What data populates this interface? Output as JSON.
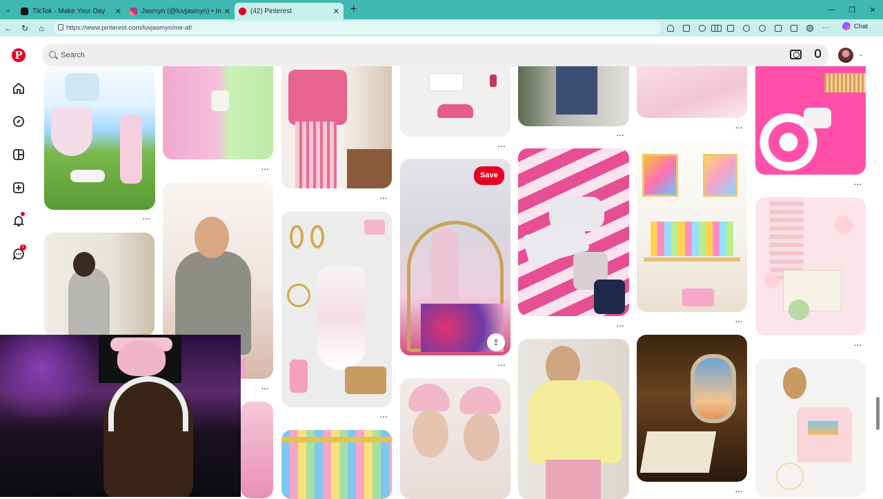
{
  "browser": {
    "tabs": [
      {
        "title": "TikTok - Make Your Day",
        "active": false,
        "favicon_color": "#111111"
      },
      {
        "title": "Jasmyn (@luvjasmyn) • Instagram",
        "active": false,
        "favicon_color": "#d62976"
      },
      {
        "title": "(42) Pinterest",
        "active": true,
        "favicon_color": "#e60023"
      }
    ],
    "new_tab_label": "+",
    "url": "https://www.pinterest.com/luvjasmyn/me-af/",
    "chat_label": "Chat",
    "accent_color": "#3fb8af"
  },
  "pinterest": {
    "brand_color": "#e60023",
    "search_placeholder": "Search",
    "notification_badge": "",
    "messages_badge": "1",
    "save_label": "Save",
    "more_label": "...",
    "rail_icons": [
      "pinterest-logo-icon",
      "home-icon",
      "explore-icon",
      "boards-icon",
      "create-icon",
      "notifications-icon",
      "messages-icon"
    ]
  }
}
